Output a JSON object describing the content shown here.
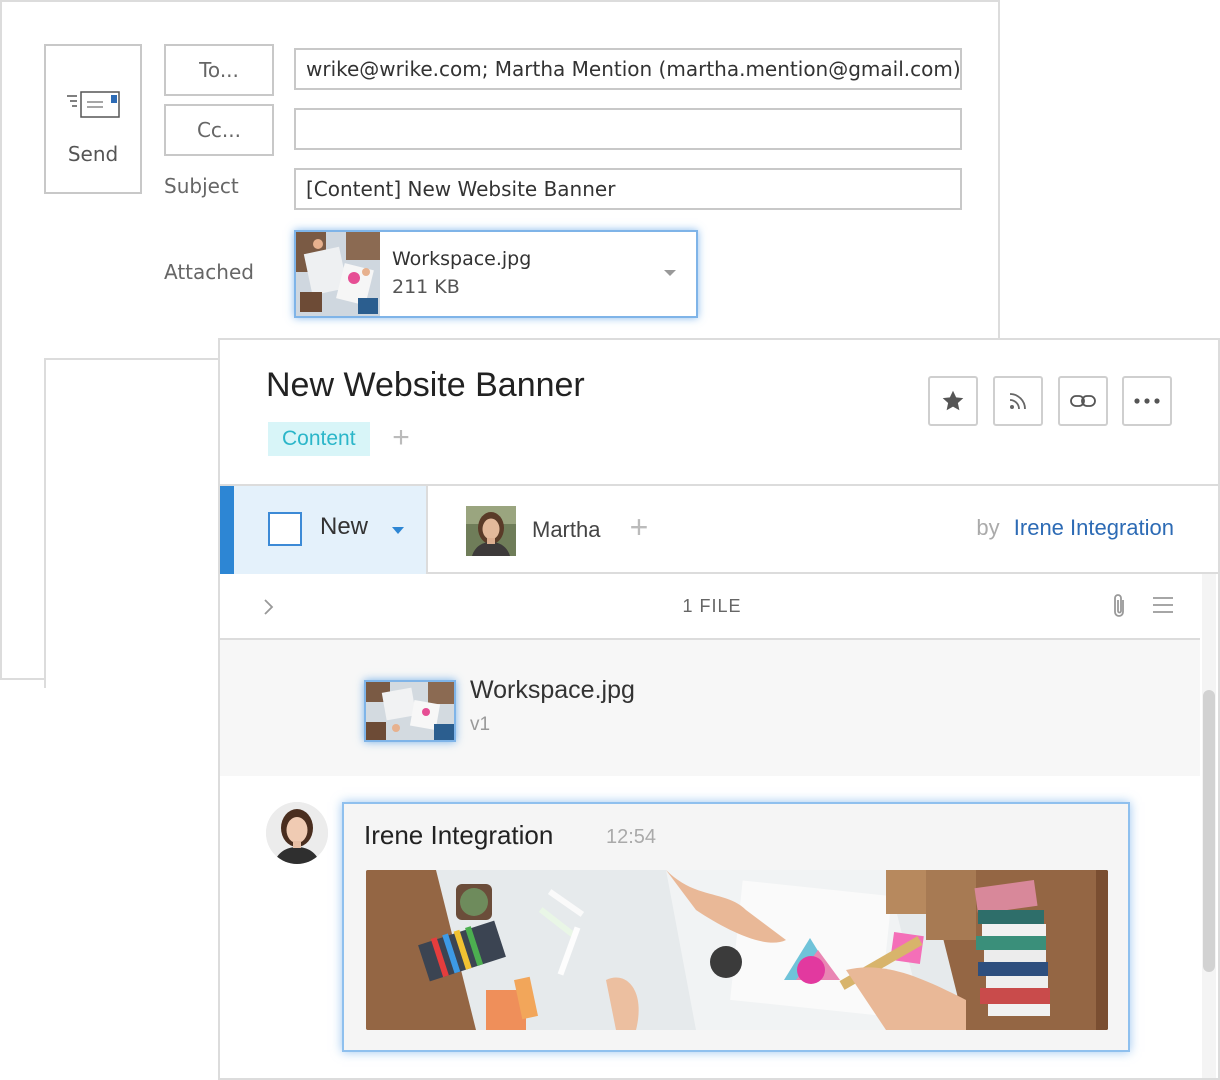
{
  "email": {
    "send_label": "Send",
    "to_label": "To...",
    "cc_label": "Cc...",
    "subject_label": "Subject",
    "attached_label": "Attached",
    "to_value": "wrike@wrike.com; Martha Mention (martha.mention@gmail.com)",
    "cc_value": "",
    "subject_value": "[Content] New Website Banner",
    "attachment": {
      "name": "Workspace.jpg",
      "size": "211 KB"
    }
  },
  "task": {
    "title": "New Website Banner",
    "folder_tag": "Content",
    "tag_add": "+",
    "actions": [
      "star-icon",
      "rss-icon",
      "link-icon",
      "more-icon"
    ],
    "status": "New",
    "assignee": "Martha",
    "assignee_add": "+",
    "by_label": "by",
    "author": "Irene Integration",
    "files_count": "1 FILE",
    "file": {
      "name": "Workspace.jpg",
      "version": "v1"
    },
    "comment": {
      "author": "Irene Integration",
      "time": "12:54"
    }
  },
  "colors": {
    "accent_blue": "#2d86d4",
    "status_bg": "#e4f1fb",
    "tag_bg": "#d8f5f8",
    "tag_text": "#2bb6c9",
    "link_blue": "#2d6bb5",
    "highlight_border": "#7fb4e8"
  }
}
